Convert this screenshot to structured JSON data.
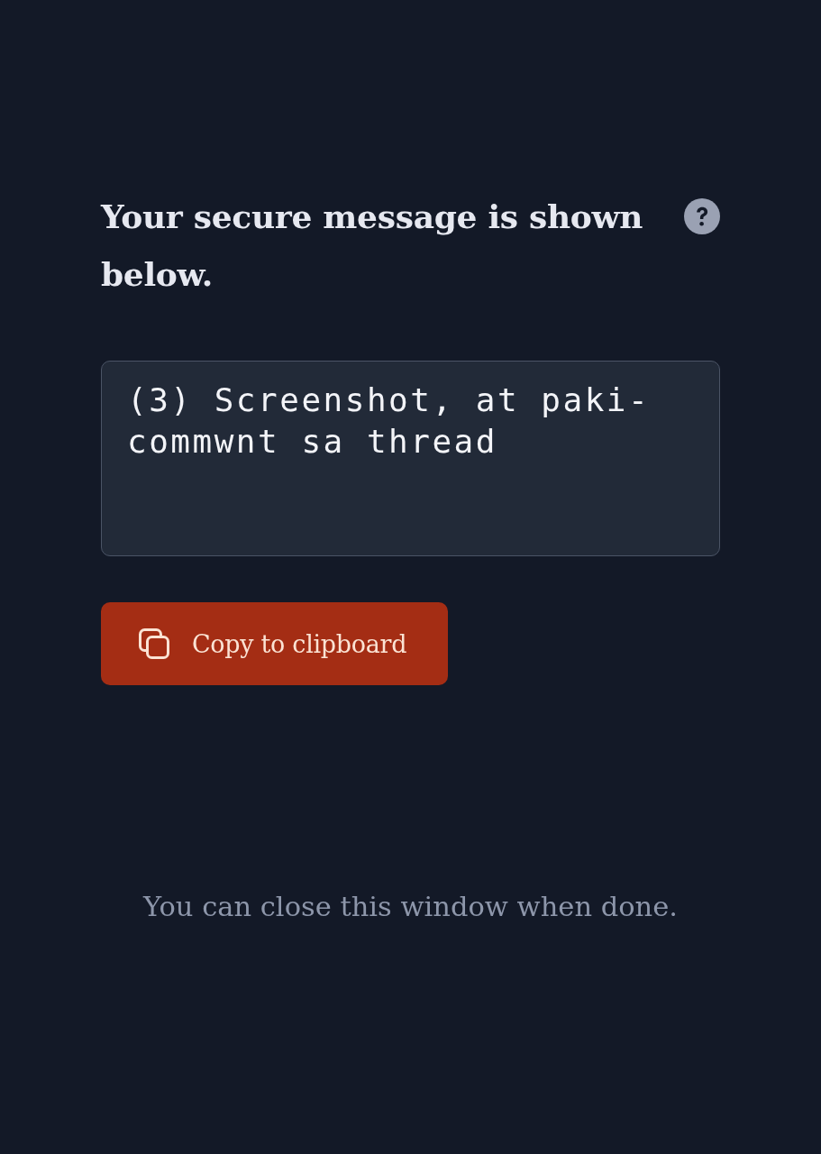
{
  "heading": "Your secure message is shown below.",
  "message_box": {
    "value": "(3) Screenshot, at paki-commwnt sa thread"
  },
  "copy_button": {
    "label": "Copy to clipboard"
  },
  "footer_note": "You can close this window when done."
}
